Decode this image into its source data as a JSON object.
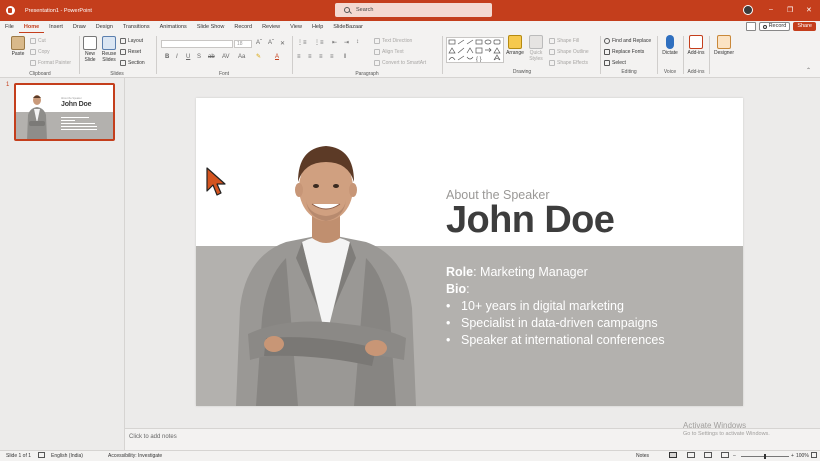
{
  "colors": {
    "accent": "#c43e1c",
    "band": "#b3b1ae",
    "name_text": "#3d3d3d"
  },
  "titlebar": {
    "doc_title": "Presentation1 - PowerPoint",
    "search_placeholder": "Search"
  },
  "menu": {
    "tabs": [
      "File",
      "Home",
      "Insert",
      "Draw",
      "Design",
      "Transitions",
      "Animations",
      "Slide Show",
      "Record",
      "Review",
      "View",
      "Help",
      "SlideBazaar"
    ],
    "active": "Home",
    "record_label": "Record",
    "share_label": "Share"
  },
  "ribbon": {
    "clipboard": {
      "paste": "Paste",
      "cut": "Cut",
      "copy": "Copy",
      "format_painter": "Format Painter",
      "label": "Clipboard"
    },
    "slides": {
      "new_slide": "New Slide",
      "reuse": "Reuse Slides",
      "layout": "Layout",
      "reset": "Reset",
      "section": "Section",
      "label": "Slides"
    },
    "font": {
      "label": "Font",
      "size": "18"
    },
    "paragraph": {
      "text_direction": "Text Direction",
      "align_text": "Align Text",
      "smartart": "Convert to SmartArt",
      "label": "Paragraph"
    },
    "drawing": {
      "arrange": "Arrange",
      "quick_styles": "Quick Styles",
      "shape_fill": "Shape Fill",
      "shape_outline": "Shape Outline",
      "shape_effects": "Shape Effects",
      "label": "Drawing"
    },
    "editing": {
      "find_replace": "Find and Replace",
      "replace_fonts": "Replace Fonts",
      "select": "Select",
      "label": "Editing"
    },
    "voice": {
      "dictate": "Dictate",
      "label": "Voice"
    },
    "addins": {
      "addins": "Add-ins",
      "label": "Add-ins"
    },
    "designer": {
      "designer": "Designer"
    }
  },
  "thumbnail": {
    "number": "1",
    "about": "About the Speaker",
    "name": "John Doe"
  },
  "slide": {
    "about": "About the Speaker",
    "name": "John Doe",
    "role_label": "Role",
    "role_value": ": Marketing Manager",
    "bio_label": "Bio",
    "bio_colon": ":",
    "bullets": [
      "10+ years in digital marketing",
      "Specialist in data-driven campaigns",
      "Speaker at international conferences"
    ]
  },
  "notes": {
    "placeholder": "Click to add notes"
  },
  "watermark": {
    "title": "Activate Windows",
    "subtitle": "Go to Settings to activate Windows."
  },
  "status": {
    "slide_info": "Slide 1 of 1",
    "language": "English (India)",
    "accessibility": "Accessibility: Investigate",
    "notes_label": "Notes",
    "zoom": "100%",
    "zoom_fraction": 0.5
  }
}
